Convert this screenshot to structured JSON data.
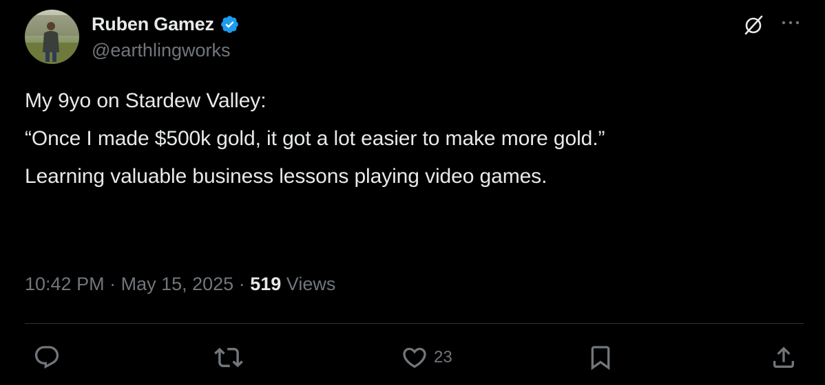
{
  "author": {
    "name": "Ruben Gamez",
    "handle": "@earthlingworks",
    "verified": true
  },
  "tweet": {
    "lines": [
      "My 9yo on Stardew Valley:",
      "“Once I made $500k gold, it got a lot easier to make more gold.”",
      "Learning valuable business lessons playing video games."
    ]
  },
  "meta": {
    "time": "10:42 PM",
    "separator": "·",
    "date": "May 15, 2025",
    "views_count": "519",
    "views_label": "Views"
  },
  "actions": {
    "reply_count": "",
    "repost_count": "",
    "like_count": "23"
  },
  "colors": {
    "background": "#000000",
    "text_primary": "#e7e9ea",
    "text_secondary": "#71767b",
    "verified_badge": "#1d9bf0",
    "divider": "#2f3336"
  },
  "icons": {
    "verified": "verified-badge-icon",
    "grok": "grok-icon",
    "more": "more-dots-icon",
    "reply": "reply-icon",
    "repost": "repost-icon",
    "like": "heart-icon",
    "bookmark": "bookmark-icon",
    "share": "share-icon"
  }
}
